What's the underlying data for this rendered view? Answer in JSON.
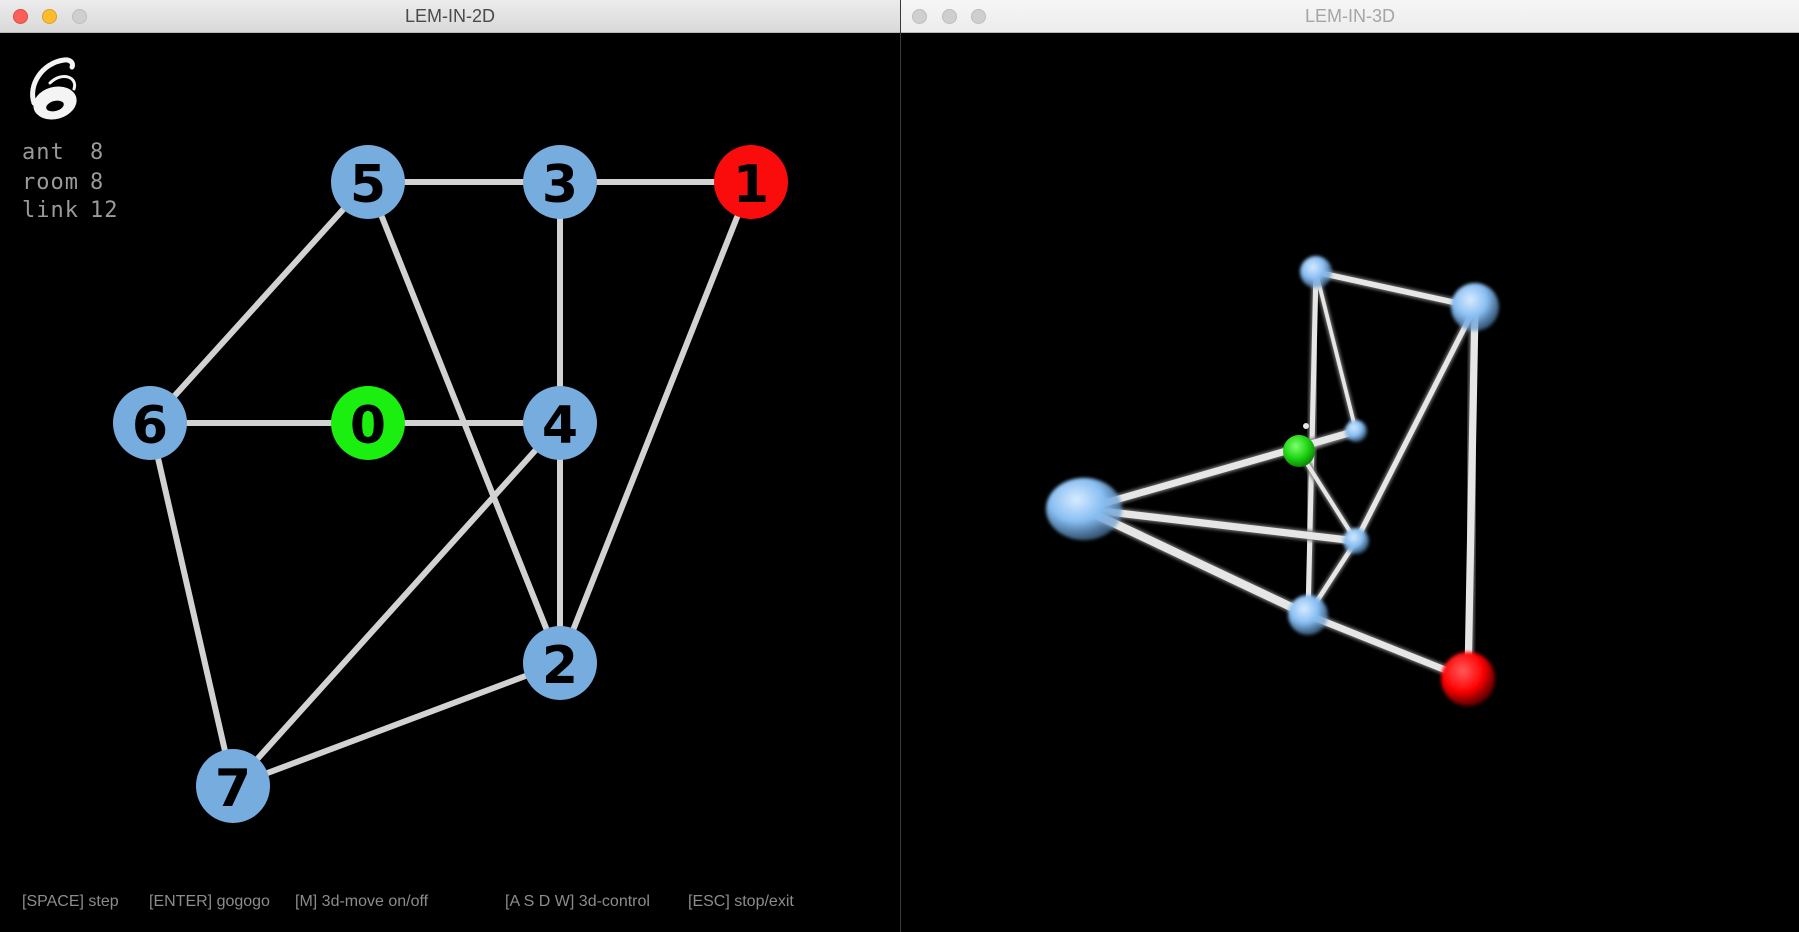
{
  "windows": {
    "left": {
      "title": "LEM-IN-2D"
    },
    "right": {
      "title": "LEM-IN-3D"
    }
  },
  "stats": [
    {
      "label": "ant",
      "value": "8"
    },
    {
      "label": "room",
      "value": "8"
    },
    {
      "label": "link",
      "value": "12"
    }
  ],
  "hints": [
    {
      "key": "[SPACE]",
      "action": "step"
    },
    {
      "key": "[ENTER]",
      "action": "gogogo"
    },
    {
      "key": "[M]",
      "action": "3d-move on/off"
    },
    {
      "key": "[A S D W]",
      "action": "3d-control"
    },
    {
      "key": "[ESC]",
      "action": "stop/exit"
    }
  ],
  "graph": {
    "rooms": [
      {
        "name": "0",
        "role": "start",
        "color": "#1aef10"
      },
      {
        "name": "1",
        "role": "end",
        "color": "#fb0c0c"
      },
      {
        "name": "2",
        "role": "room",
        "color": "#77acdf"
      },
      {
        "name": "3",
        "role": "room",
        "color": "#77acdf"
      },
      {
        "name": "4",
        "role": "room",
        "color": "#77acdf"
      },
      {
        "name": "5",
        "role": "room",
        "color": "#77acdf"
      },
      {
        "name": "6",
        "role": "room",
        "color": "#77acdf"
      },
      {
        "name": "7",
        "role": "room",
        "color": "#77acdf"
      }
    ],
    "links": [
      [
        "5",
        "3"
      ],
      [
        "3",
        "1"
      ],
      [
        "5",
        "6"
      ],
      [
        "5",
        "2"
      ],
      [
        "3",
        "4"
      ],
      [
        "6",
        "0"
      ],
      [
        "0",
        "4"
      ],
      [
        "4",
        "2"
      ],
      [
        "4",
        "7"
      ],
      [
        "1",
        "2"
      ],
      [
        "6",
        "7"
      ],
      [
        "7",
        "2"
      ]
    ],
    "link_color": "#d2d2d2"
  },
  "logo_icon": "ant-swirl-logo-icon"
}
